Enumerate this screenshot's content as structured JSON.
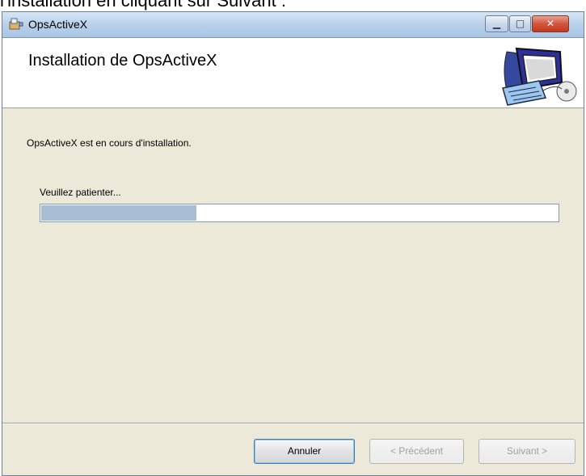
{
  "page_caption": "l'installation en cliquant sur Suivant :",
  "window": {
    "title": "OpsActiveX",
    "app_icon": "installer-icon",
    "controls": {
      "minimize": "minimize-icon",
      "maximize": "maximize-icon",
      "close": "close-icon"
    }
  },
  "header": {
    "title": "Installation de OpsActiveX",
    "image": "computer-setup-icon"
  },
  "body": {
    "status_text": "OpsActiveX est en cours d'installation.",
    "wait_label": "Veuillez patienter...",
    "progress_fraction": 0.3
  },
  "footer": {
    "cancel_label": "Annuler",
    "back_label": "< Précédent",
    "next_label": "Suivant >"
  },
  "colors": {
    "progress_fill": "#a9bdd5",
    "dialog_background": "#ece9d8"
  }
}
